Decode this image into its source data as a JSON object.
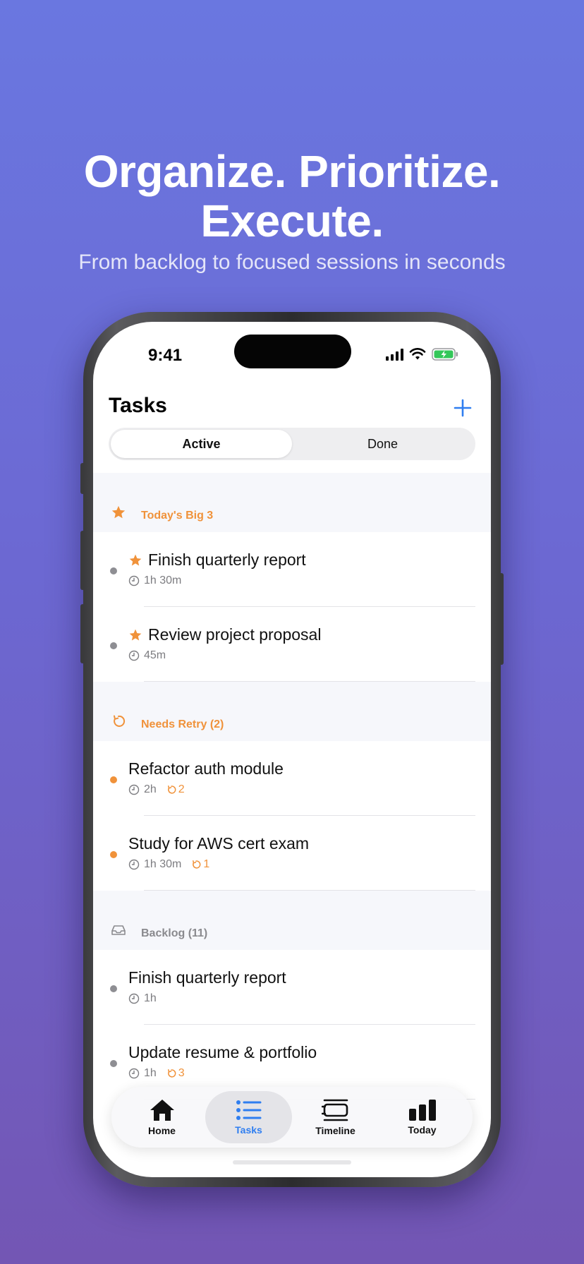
{
  "hero": {
    "headline_line1": "Organize. Prioritize.",
    "headline_line2": "Execute.",
    "subheadline": "From backlog to focused sessions in seconds"
  },
  "status_bar": {
    "time": "9:41"
  },
  "nav": {
    "title": "Tasks",
    "add_icon": "plus-icon"
  },
  "segment": {
    "options": [
      "Active",
      "Done"
    ],
    "selected": "Active"
  },
  "sections": [
    {
      "title": "Today's Big 3",
      "icon": "star-icon",
      "tasks": [
        {
          "title": "Finish quarterly report",
          "duration": "1h 30m",
          "starred": true,
          "retry": null
        },
        {
          "title": "Review project proposal",
          "duration": "45m",
          "starred": true,
          "retry": null
        }
      ]
    },
    {
      "title": "Needs Retry (2)",
      "icon": "retry-icon",
      "tasks": [
        {
          "title": "Refactor auth module",
          "duration": "2h",
          "starred": false,
          "retry": "2"
        },
        {
          "title": "Study for AWS cert exam",
          "duration": "1h 30m",
          "starred": false,
          "retry": "1"
        }
      ]
    },
    {
      "title": "Backlog (11)",
      "icon": "inbox-icon",
      "tasks": [
        {
          "title": "Finish quarterly report",
          "duration": "1h",
          "starred": false,
          "retry": null
        },
        {
          "title": "Update resume & portfolio",
          "duration": "1h",
          "starred": false,
          "retry": "3"
        }
      ]
    }
  ],
  "tab_bar": {
    "tabs": [
      {
        "label": "Home",
        "icon": "house-icon"
      },
      {
        "label": "Tasks",
        "icon": "list-icon"
      },
      {
        "label": "Timeline",
        "icon": "timeline-icon"
      },
      {
        "label": "Today",
        "icon": "bar-chart-icon"
      }
    ],
    "selected": "Tasks"
  },
  "colors": {
    "accent": "#2f7ef0",
    "orange": "#f0923a",
    "muted": "#8a8a8e",
    "background_top": "#6a77e0",
    "background_bottom": "#7356b4"
  }
}
